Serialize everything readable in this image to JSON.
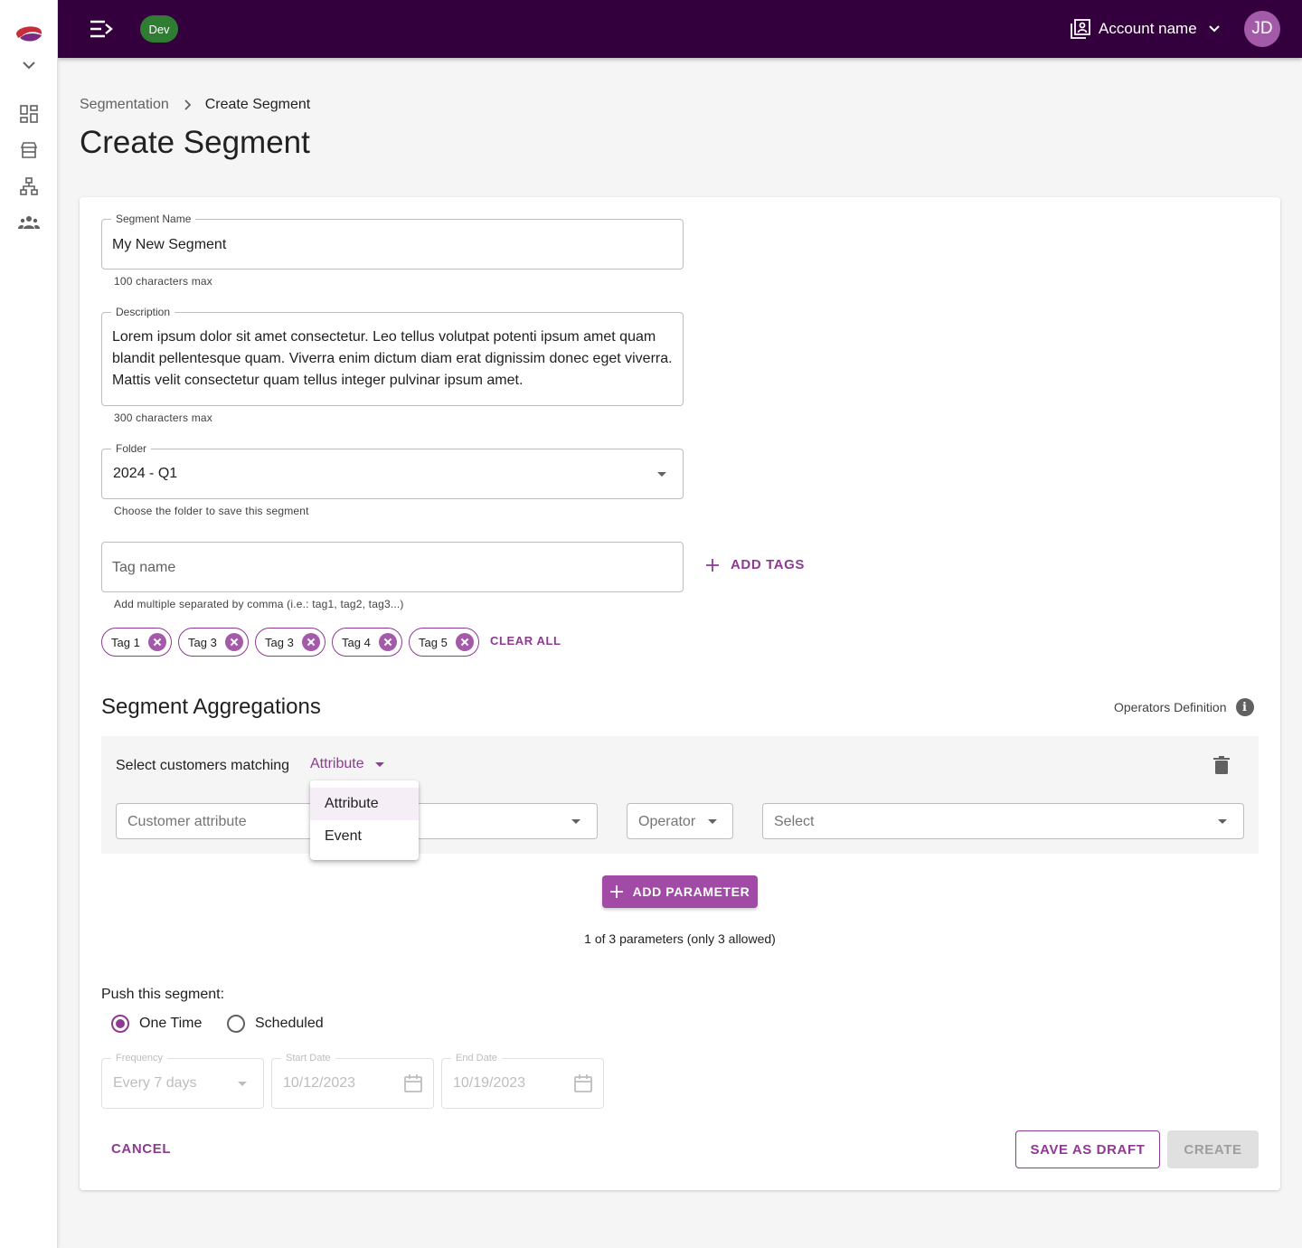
{
  "nav": {
    "rail_icons": [
      "logo-icon",
      "chevron-down-icon",
      "dashboard-icon",
      "store-icon",
      "hierarchy-icon",
      "groups-icon"
    ]
  },
  "topbar": {
    "env_badge": "Dev",
    "account_name": "Account name",
    "avatar_initials": "JD",
    "background": "#33003d"
  },
  "breadcrumb": {
    "parent": "Segmentation",
    "current": "Create Segment"
  },
  "page": {
    "title": "Create Segment"
  },
  "form": {
    "segment_name": {
      "label": "Segment Name",
      "value": "My New Segment",
      "helper": "100 characters max"
    },
    "description": {
      "label": "Description",
      "value": "Lorem ipsum dolor sit amet consectetur. Leo tellus volutpat potenti ipsum amet quam blandit pellentesque quam. Viverra enim dictum diam erat dignissim donec eget viverra. Mattis velit consectetur quam tellus integer pulvinar ipsum amet.",
      "helper": "300 characters max"
    },
    "folder": {
      "label": "Folder",
      "value": "2024 - Q1",
      "helper": "Choose the folder to save this segment"
    },
    "tags": {
      "placeholder": "Tag name",
      "helper": "Add multiple separated by comma (i.e.: tag1, tag2, tag3...)",
      "add_label": "ADD TAGS",
      "chips": [
        "Tag 1",
        "Tag 3",
        "Tag 3",
        "Tag 4",
        "Tag 5"
      ],
      "clear_label": "CLEAR ALL"
    }
  },
  "aggregations": {
    "title": "Segment Aggregations",
    "operators_link": "Operators Definition",
    "rule": {
      "label": "Select customers matching",
      "match_type": "Attribute",
      "attribute_placeholder": "Customer attribute",
      "operator_placeholder": "Operator",
      "value_placeholder": "Select"
    },
    "menu_options": [
      "Attribute",
      "Event"
    ],
    "add_parameter": "ADD PARAMETER",
    "parameter_count": "1 of 3 parameters (only 3 allowed)"
  },
  "push": {
    "label": "Push this segment:",
    "options": [
      "One Time",
      "Scheduled"
    ],
    "selected": "One Time",
    "frequency": {
      "label": "Frequency",
      "value": "Every 7 days"
    },
    "start_date": {
      "label": "Start Date",
      "value": "10/12/2023"
    },
    "end_date": {
      "label": "End Date",
      "value": "10/19/2023"
    }
  },
  "actions": {
    "cancel": "CANCEL",
    "save_draft": "SAVE AS DRAFT",
    "create": "CREATE"
  },
  "colors": {
    "primary": "#8e3a93",
    "primary_button": "#a14aa6",
    "env_badge": "#2e7d32"
  }
}
